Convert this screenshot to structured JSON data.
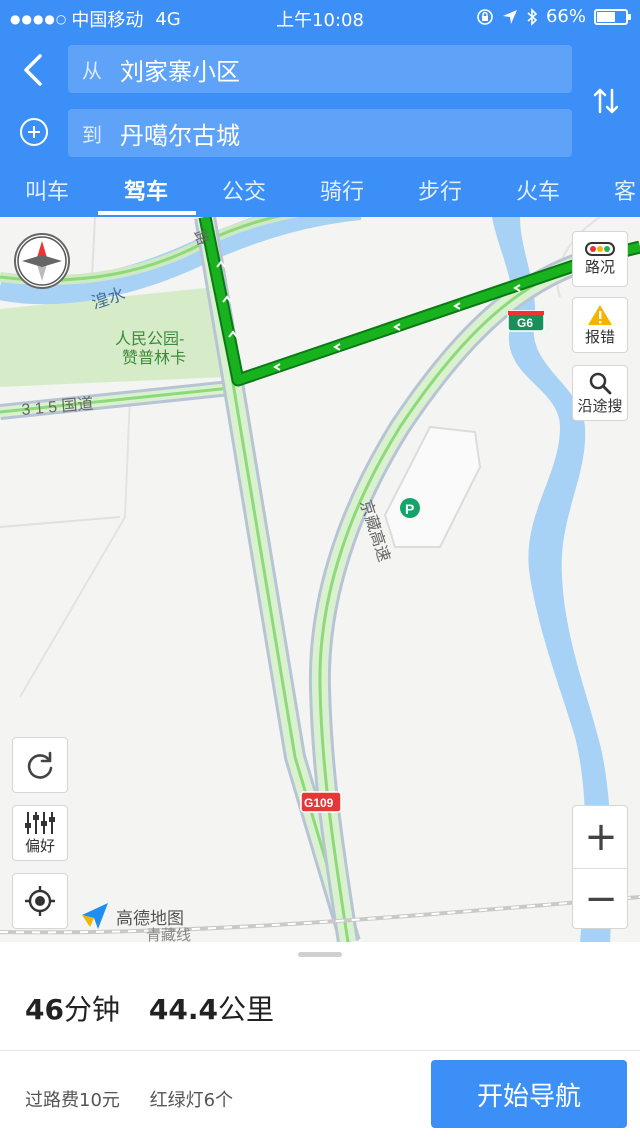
{
  "status_bar": {
    "carrier": "中国移动",
    "network": "4G",
    "time": "上午10:08",
    "battery": "66%",
    "battery_level": 0.66
  },
  "route_form": {
    "from_prefix": "从",
    "from_value": "刘家寨小区",
    "to_prefix": "到",
    "to_value": "丹噶尔古城"
  },
  "tabs": [
    {
      "label": "叫车"
    },
    {
      "label": "驾车"
    },
    {
      "label": "公交"
    },
    {
      "label": "骑行"
    },
    {
      "label": "步行"
    },
    {
      "label": "火车"
    },
    {
      "label": "客"
    }
  ],
  "active_tab": "驾车",
  "map": {
    "labels": {
      "river": "湟水",
      "park_line1": "人民公园-",
      "park_line2": "赞普林卡",
      "road_315": "3 1 5 国道",
      "expressway": "京藏高速",
      "road_top": "路",
      "rail": "青藏线",
      "shield_g6": "G6",
      "shield_g109": "G109"
    },
    "controls": {
      "traffic": "路况",
      "report": "报错",
      "along_search": "沿途搜",
      "preference": "偏好",
      "zoom_in": "+",
      "zoom_out": "−"
    },
    "logo_text": "高德地图"
  },
  "summary": {
    "duration_num": "46",
    "duration_unit": "分钟",
    "distance_num": "44.4",
    "distance_unit": "公里",
    "toll": "过路费10元",
    "lights": "红绿灯6个",
    "start_button": "开始导航"
  },
  "colors": {
    "accent": "#3b8ff6",
    "route_green": "#19b21f",
    "road_green": "#8ed97a",
    "water": "#a8d2f5",
    "park": "#d6ecc9"
  }
}
